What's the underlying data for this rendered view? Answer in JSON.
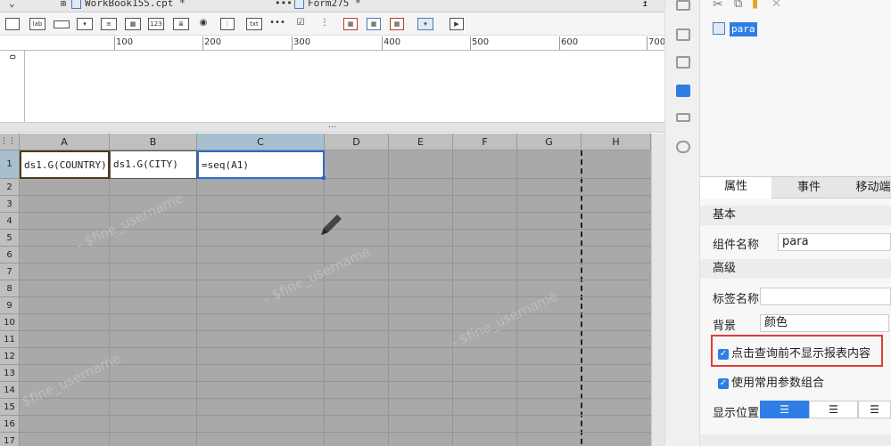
{
  "tabs": [
    {
      "label": "WorkBook155.cpt *"
    },
    {
      "label": "Form275 *"
    }
  ],
  "toolbar": {
    "lab_label": "lab",
    "num_label": "123",
    "txt_label": "txt"
  },
  "ruler": {
    "h_ticks": [
      "100",
      "200",
      "300",
      "400",
      "500",
      "600",
      "700"
    ],
    "v_tick": "0"
  },
  "splitter_label": "...",
  "grid": {
    "columns": [
      "A",
      "B",
      "C",
      "D",
      "E",
      "F",
      "G",
      "H"
    ],
    "rows": [
      "1",
      "2",
      "3",
      "4",
      "5",
      "6",
      "7",
      "8",
      "9",
      "10",
      "11",
      "12",
      "13",
      "14",
      "15",
      "16",
      "17"
    ],
    "cells": {
      "a1": "ds1.G(COUNTRY)",
      "b1": "ds1.G(CITY)",
      "c1": "=seq(A1)"
    },
    "watermark": "- $fine_username"
  },
  "widget_tree": {
    "selected_item": "para"
  },
  "panel": {
    "tabs": [
      "属性",
      "事件",
      "移动端"
    ],
    "sections": {
      "basic": "基本",
      "advanced": "高级"
    },
    "fields": {
      "widget_name_label": "组件名称",
      "widget_name_value": "para",
      "tag_name_label": "标签名称",
      "tag_name_value": "",
      "background_label": "背景",
      "background_value": "颜色",
      "hide_before_query_label": "点击查询前不显示报表内容",
      "use_common_params_label": "使用常用参数组合",
      "display_position_label": "显示位置"
    }
  },
  "colors": {
    "accent": "#2f7ee6",
    "highlight_border": "#e53935",
    "selected_cell": "#2a6bc9"
  }
}
